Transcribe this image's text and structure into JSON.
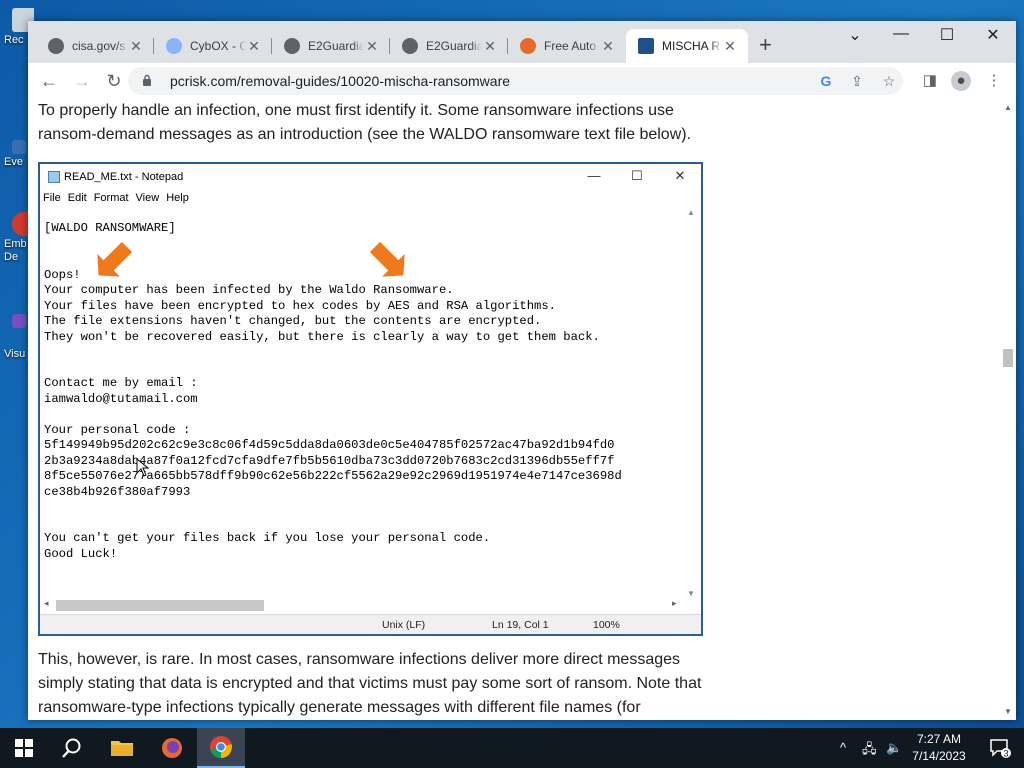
{
  "desktop": {
    "icons": [
      {
        "label": "Rec",
        "color": "#c9d4df"
      },
      {
        "label": "Eve",
        "color": "#3a6fb4"
      },
      {
        "label": "Emb De",
        "color": "#d23a2e"
      },
      {
        "label": "Visu",
        "color": "#7a4fc2"
      }
    ]
  },
  "browser": {
    "tabs": [
      {
        "title": "cisa.gov/s",
        "active": false
      },
      {
        "title": "CybOX - C",
        "active": false
      },
      {
        "title": "E2Guardia",
        "active": false
      },
      {
        "title": "E2Guardia",
        "active": false
      },
      {
        "title": "Free Auto",
        "active": false
      },
      {
        "title": "MISCHA R",
        "active": true
      }
    ],
    "new_tab": "+",
    "url": "pcrisk.com/removal-guides/10020-mischa-ransomware"
  },
  "page": {
    "intro": "To properly handle an infection, one must first identify it. Some ransomware infections use ransom-demand messages as an introduction (see the WALDO ransomware text file below).",
    "outro": "This, however, is rare. In most cases, ransomware infections deliver more direct messages simply stating that data is encrypted and that victims must pay some sort of ransom. Note that ransomware-type infections typically generate messages with different file names (for"
  },
  "notepad": {
    "title": "READ_ME.txt - Notepad",
    "menu": [
      "File",
      "Edit",
      "Format",
      "View",
      "Help"
    ],
    "text": "[WALDO RANSOMWARE]\n\n\nOops!\nYour computer has been infected by the Waldo Ransomware.\nYour files have been encrypted to hex codes by AES and RSA algorithms.\nThe file extensions haven't changed, but the contents are encrypted.\nThey won't be recovered easily, but there is clearly a way to get them back.\n\n\nContact me by email :\niamwaldo@tutamail.com\n\nYour personal code :\n5f149949b95d202c62c9e3c8c06f4d59c5dda8da0603de0c5e404785f02572ac47ba92d1b94fd0\n2b3a9234a8dab4a87f0a12fcd7cfa9dfe7fb5b5610dba73c3dd0720b7683c2cd31396db55eff7f\n8f5ce55076e277a665bb578dff9b90c62e56b222cf5562a29e92c2969d1951974e4e7147ce3698d\nce38b4b926f380af7993\n\n\nYou can't get your files back if you lose your personal code.\nGood Luck!",
    "status": {
      "encoding": "Unix (LF)",
      "position": "Ln 19, Col 1",
      "zoom": "100%"
    }
  },
  "taskbar": {
    "clock_time": "7:27 AM",
    "clock_date": "7/14/2023",
    "notification_count": "3"
  },
  "colors": {
    "arrow": "#f07a1a",
    "notepad_border": "#2b5f8f",
    "taskbar": "#101820",
    "chrome_tabbar": "#dee1e6"
  }
}
